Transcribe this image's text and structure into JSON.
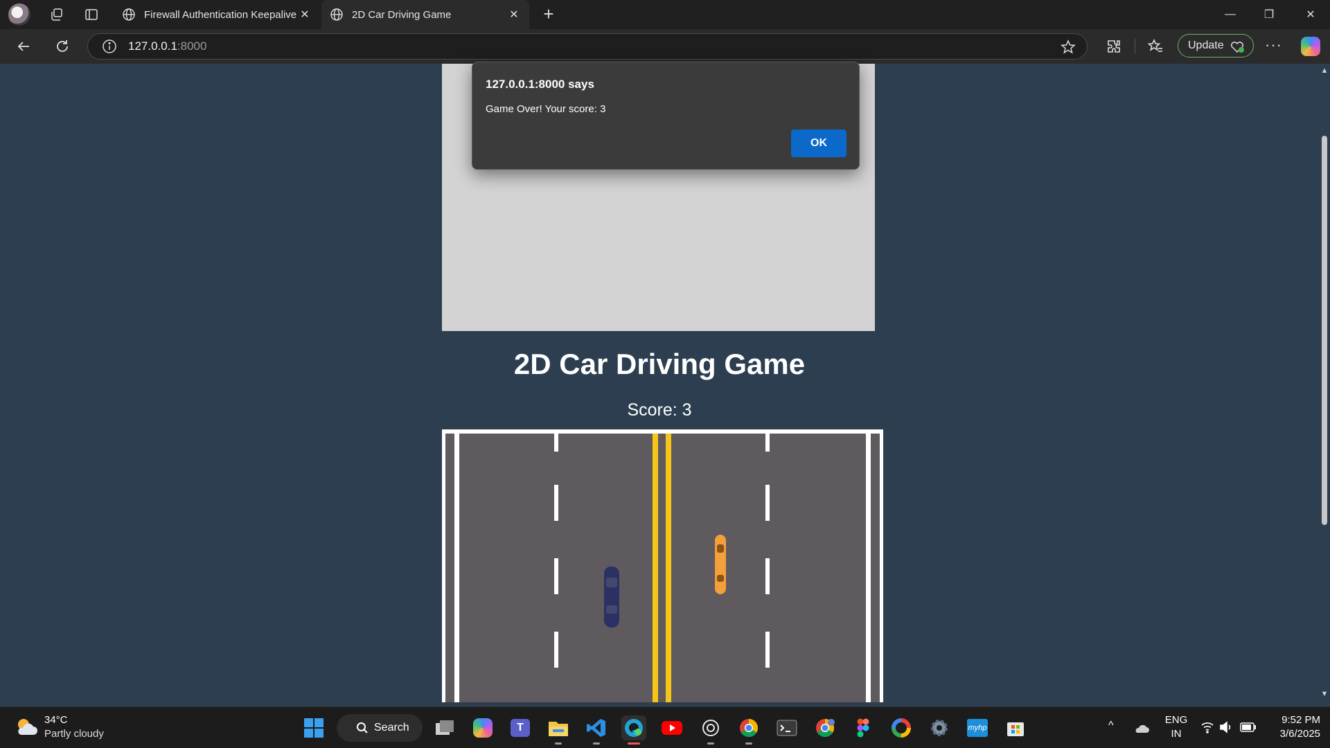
{
  "browser": {
    "tabs": [
      {
        "title": "Firewall Authentication Keepalive",
        "active": false
      },
      {
        "title": "2D Car Driving Game",
        "active": true
      }
    ],
    "address": {
      "host": "127.0.0.1",
      "port": ":8000"
    },
    "update_label": "Update",
    "window_controls": {
      "minimize": "—",
      "restore": "❐",
      "close": "✕"
    }
  },
  "dialog": {
    "title": "127.0.0.1:8000 says",
    "message": "Game Over! Your score: 3",
    "ok_label": "OK"
  },
  "game": {
    "title": "2D Car Driving Game",
    "score_text": "Score: 3",
    "colors": {
      "background": "#2c3e50",
      "canvas": "#d3d3d3",
      "road": "#5f5a5e",
      "center_line": "#f5c518",
      "player_car": "#2a3163",
      "obstacle_car": "#f3a03b"
    }
  },
  "taskbar": {
    "weather": {
      "temp": "34°C",
      "desc": "Partly cloudy"
    },
    "search_label": "Search",
    "tray": {
      "lang1": "ENG",
      "lang2": "IN",
      "time": "9:52 PM",
      "date": "3/6/2025"
    }
  }
}
